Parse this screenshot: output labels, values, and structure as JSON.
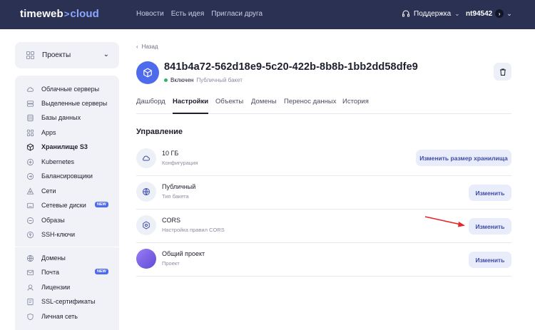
{
  "header": {
    "logo_main": "timeweb",
    "logo_accent": "cloud",
    "nav": [
      "Новости",
      "Есть идея",
      "Пригласи друга"
    ],
    "support_label": "Поддержка",
    "username": "nt94542"
  },
  "sidebar": {
    "projects_label": "Проекты",
    "items": [
      {
        "label": "Облачные серверы",
        "icon": "cloud-icon"
      },
      {
        "label": "Выделенные серверы",
        "icon": "server-icon"
      },
      {
        "label": "Базы данных",
        "icon": "database-icon"
      },
      {
        "label": "Apps",
        "icon": "apps-icon"
      },
      {
        "label": "Хранилище S3",
        "icon": "cube-icon"
      },
      {
        "label": "Kubernetes",
        "icon": "kubernetes-icon"
      },
      {
        "label": "Балансировщики",
        "icon": "balancer-icon"
      },
      {
        "label": "Сети",
        "icon": "network-icon"
      },
      {
        "label": "Сетевые диски",
        "icon": "disk-icon",
        "badge": "NEW"
      },
      {
        "label": "Образы",
        "icon": "image-icon"
      },
      {
        "label": "SSH-ключи",
        "icon": "key-icon"
      },
      {
        "label": "Домены",
        "icon": "globe-icon"
      },
      {
        "label": "Почта",
        "icon": "mail-icon",
        "badge": "NEW"
      },
      {
        "label": "Лицензии",
        "icon": "license-icon"
      },
      {
        "label": "SSL-сертификаты",
        "icon": "certificate-icon"
      },
      {
        "label": "Личная сеть",
        "icon": "shield-icon"
      }
    ]
  },
  "main": {
    "back_label": "Назад",
    "bucket_name": "841b4a72-562d18e9-5c20-422b-8b8b-1bb2dd58dfe9",
    "status": "Включен",
    "bucket_type": "Публичный бакет",
    "tabs": [
      "Дашборд",
      "Настройки",
      "Объекты",
      "Домены",
      "Перенос данных",
      "История"
    ],
    "active_tab": "Настройки",
    "section_title": "Управление",
    "rows": [
      {
        "title": "10 ГБ",
        "subtitle": "Конфигурация",
        "button": "Изменить размер хранилища",
        "icon": "cloud-icon"
      },
      {
        "title": "Публичный",
        "subtitle": "Тип бакета",
        "button": "Изменить",
        "icon": "globe-icon"
      },
      {
        "title": "CORS",
        "subtitle": "Настройка правил CORS",
        "button": "Изменить",
        "icon": "gear-icon"
      },
      {
        "title": "Общий проект",
        "subtitle": "Проект",
        "button": "Изменить",
        "icon": "project-avatar"
      }
    ]
  },
  "colors": {
    "topbar": "#2b3152",
    "accent": "#4f6bed",
    "button_bg": "#e9ecfa",
    "status_green": "#2fb36a",
    "annotation_arrow": "#e5262a"
  }
}
